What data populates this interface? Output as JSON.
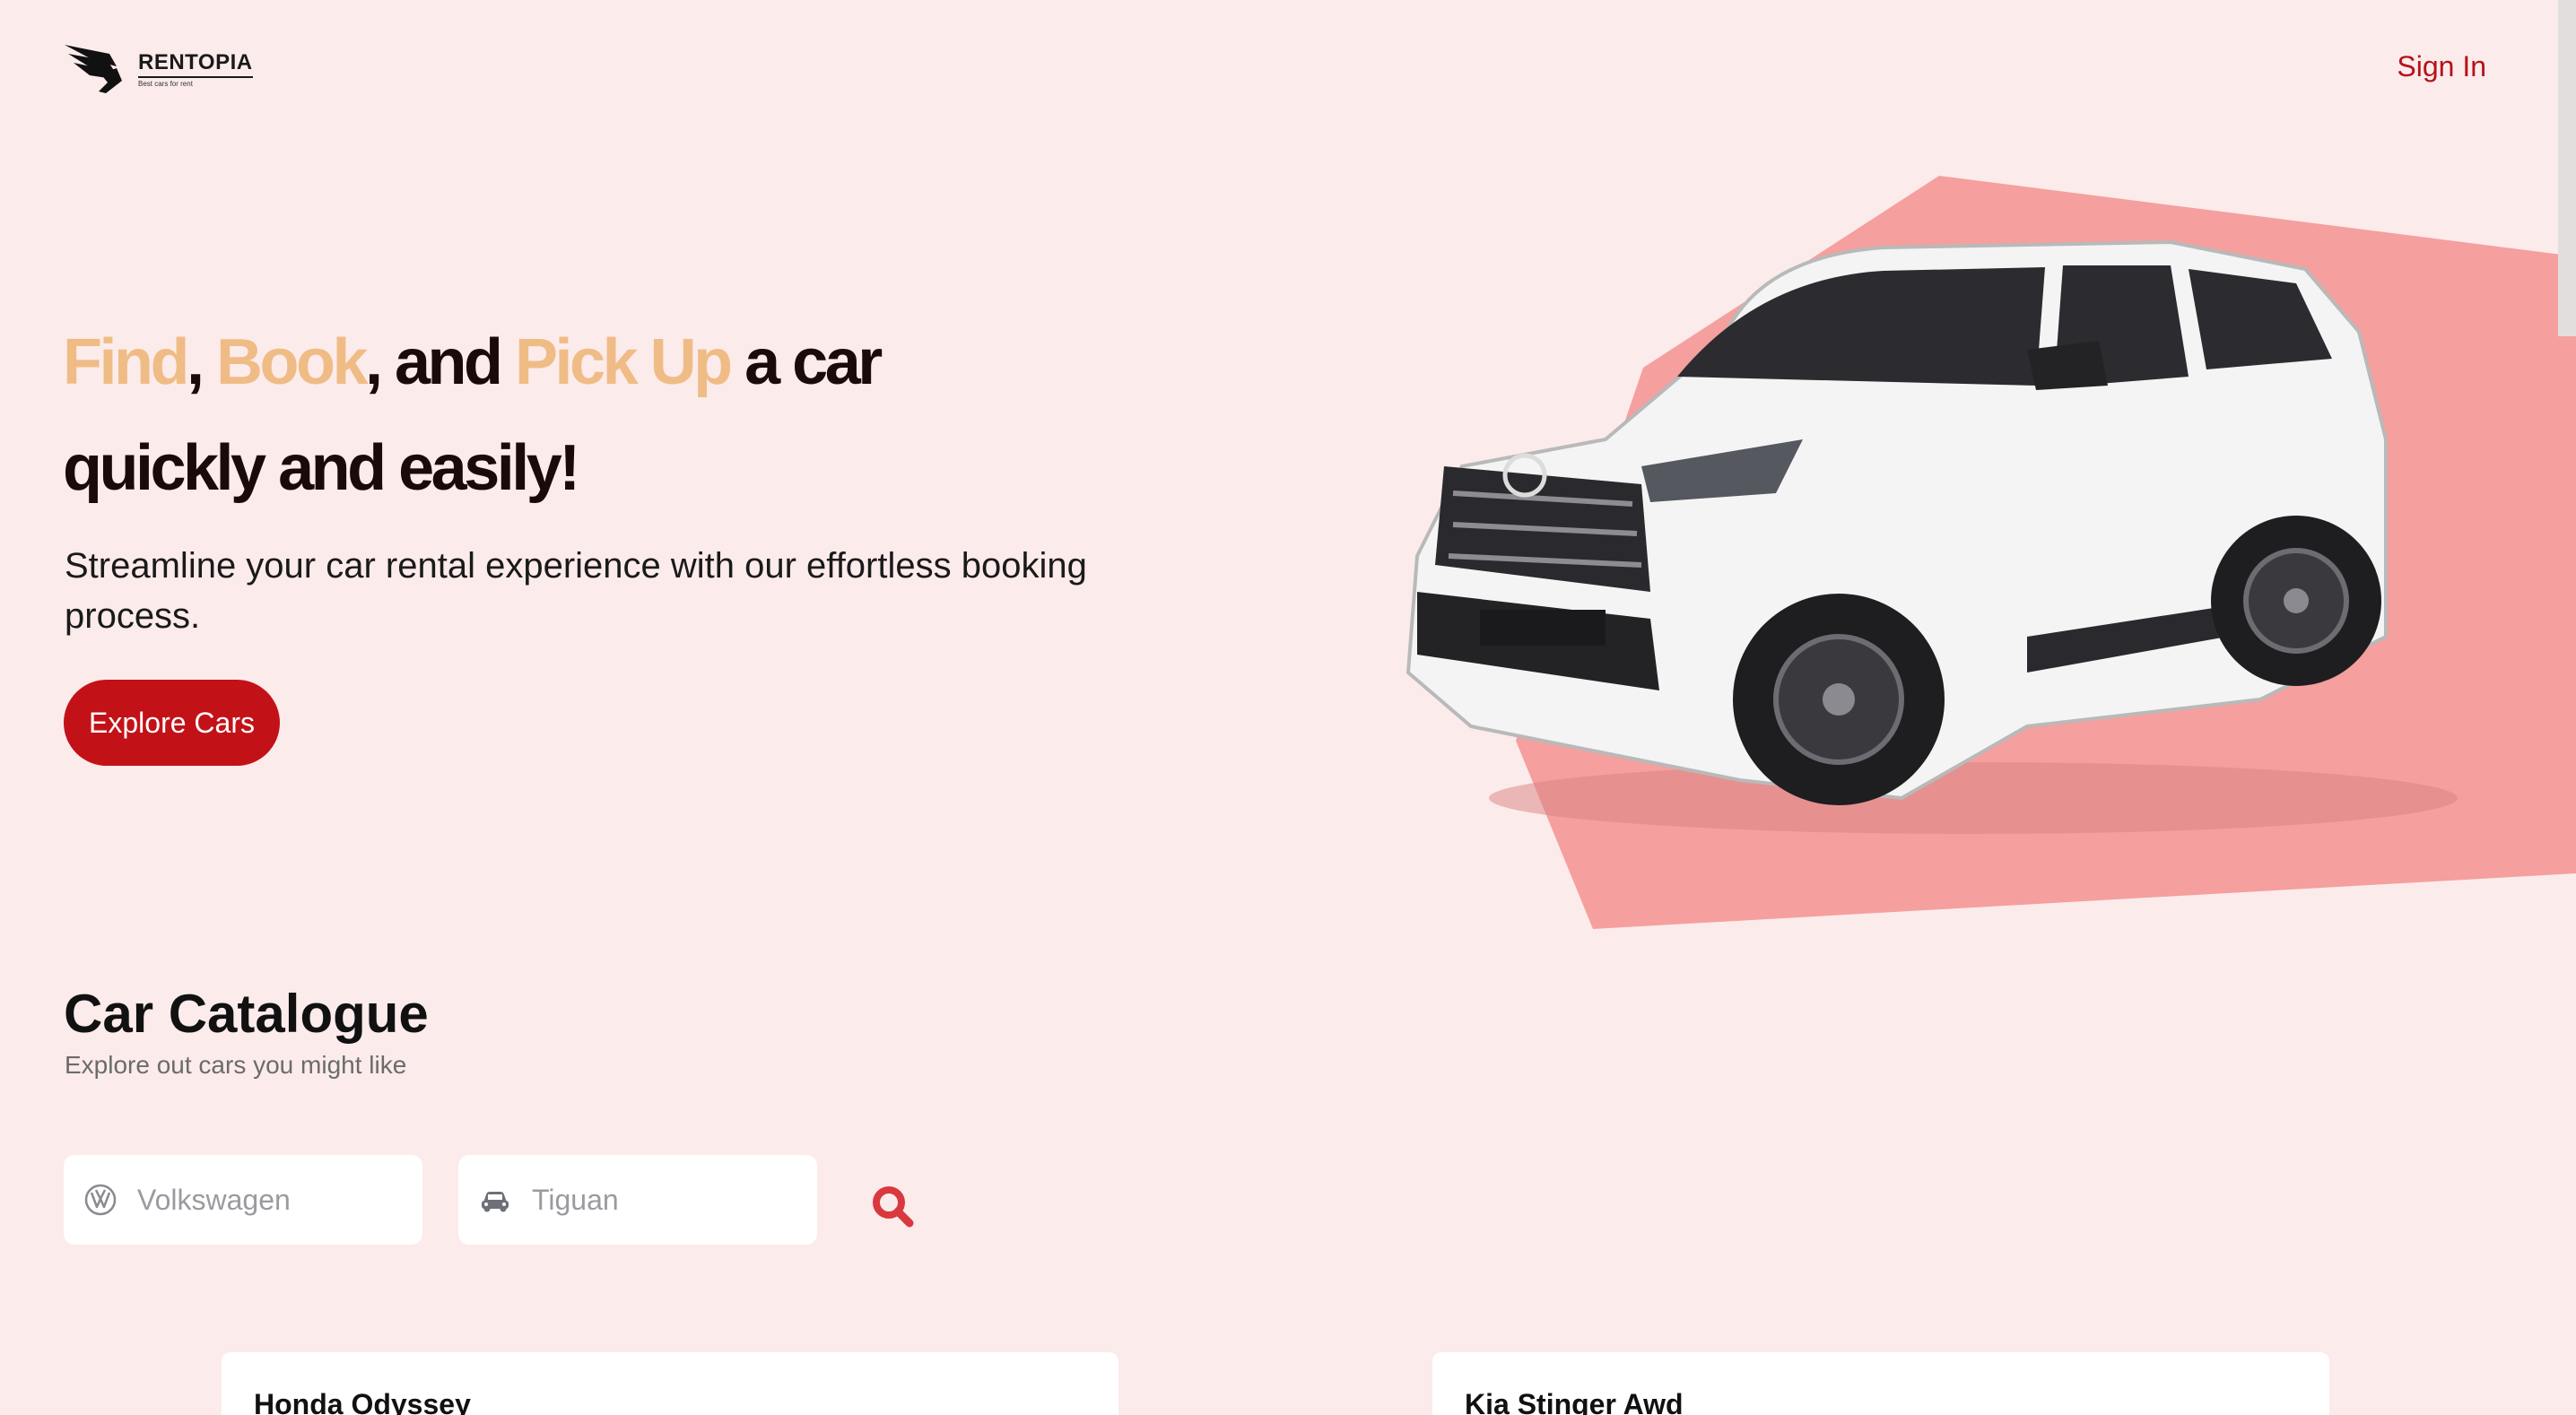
{
  "brand": {
    "name": "RENTOPIA",
    "tagline": "Best cars for rent"
  },
  "header": {
    "sign_in_label": "Sign In"
  },
  "hero": {
    "title_find": "Find",
    "title_sep1": ",",
    "title_book": "Book",
    "title_and": ", and",
    "title_pickup": "Pick Up",
    "title_acar": "a car",
    "title_line2": "quickly and easily!",
    "subtitle": "Streamline your car rental experience with our effortless booking process.",
    "cta_label": "Explore Cars"
  },
  "catalogue": {
    "title": "Car Catalogue",
    "subtitle": "Explore out cars you might like",
    "manufacturer_placeholder": "Volkswagen",
    "model_placeholder": "Tiguan"
  },
  "cars": [
    {
      "name": "Honda Odyssey"
    },
    {
      "name": "Kia Stinger Awd"
    }
  ],
  "colors": {
    "background": "#fcebeb",
    "accent": "#c21218",
    "highlight": "#f0bc86",
    "hero_shape": "#f59f9f"
  },
  "icons": {
    "logo": "wing-logo-icon",
    "manufacturer": "volkswagen-logo-icon",
    "model": "car-icon",
    "search": "magnifier-icon"
  }
}
